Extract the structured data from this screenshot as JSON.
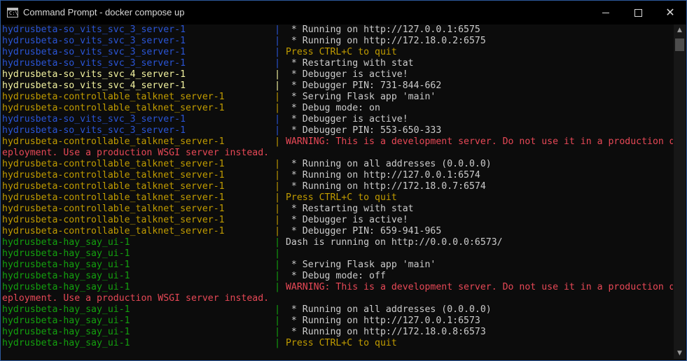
{
  "window": {
    "title": "Command Prompt - docker  compose up",
    "icon_text": "C:\\",
    "icon_name": "cmd-icon",
    "controls": {
      "minimize": "minimize-icon",
      "maximize": "maximize-icon",
      "close": "close-icon"
    }
  },
  "colors": {
    "svc3_blue": "#2a55d6",
    "svc4_yellow": "#f2f2a0",
    "talknet_gold": "#c19c00",
    "hay_say_green": "#13a10e",
    "warning_red": "#e74856",
    "output_white": "#cccccc",
    "frame_border": "#2d5a9e"
  },
  "console": {
    "lines": [
      {
        "prefix": "hydrusbeta-so_vits_svc_3_server-1",
        "pc": "blue",
        "sep": "|",
        "text": " * Running on http://127.0.0.1:6575",
        "tc": "white"
      },
      {
        "prefix": "hydrusbeta-so_vits_svc_3_server-1",
        "pc": "blue",
        "sep": "|",
        "text": " * Running on http://172.18.0.2:6575",
        "tc": "white"
      },
      {
        "prefix": "hydrusbeta-so_vits_svc_3_server-1",
        "pc": "blue",
        "sep": "|",
        "text": "Press CTRL+C to quit",
        "tc": "gold"
      },
      {
        "prefix": "hydrusbeta-so_vits_svc_3_server-1",
        "pc": "blue",
        "sep": "|",
        "text": " * Restarting with stat",
        "tc": "white"
      },
      {
        "prefix": "hydrusbeta-so_vits_svc_4_server-1",
        "pc": "yellow",
        "sep": "|",
        "text": " * Debugger is active!",
        "tc": "white"
      },
      {
        "prefix": "hydrusbeta-so_vits_svc_4_server-1",
        "pc": "yellow",
        "sep": "|",
        "text": " * Debugger PIN: 731-844-662",
        "tc": "white"
      },
      {
        "prefix": "hydrusbeta-controllable_talknet_server-1",
        "pc": "gold",
        "sep": "|",
        "text": " * Serving Flask app 'main'",
        "tc": "white"
      },
      {
        "prefix": "hydrusbeta-controllable_talknet_server-1",
        "pc": "gold",
        "sep": "|",
        "text": " * Debug mode: on",
        "tc": "white"
      },
      {
        "prefix": "hydrusbeta-so_vits_svc_3_server-1",
        "pc": "blue",
        "sep": "|",
        "text": " * Debugger is active!",
        "tc": "white"
      },
      {
        "prefix": "hydrusbeta-so_vits_svc_3_server-1",
        "pc": "blue",
        "sep": "|",
        "text": " * Debugger PIN: 553-650-333",
        "tc": "white"
      },
      {
        "prefix": "hydrusbeta-controllable_talknet_server-1",
        "pc": "gold",
        "sep": "|",
        "text": "WARNING: This is a development server. Do not use it in a production d",
        "tc": "red"
      },
      {
        "prefix": "",
        "pc": "red",
        "sep": "",
        "text": "eployment. Use a production WSGI server instead.",
        "tc": "red"
      },
      {
        "prefix": "hydrusbeta-controllable_talknet_server-1",
        "pc": "gold",
        "sep": "|",
        "text": " * Running on all addresses (0.0.0.0)",
        "tc": "white"
      },
      {
        "prefix": "hydrusbeta-controllable_talknet_server-1",
        "pc": "gold",
        "sep": "|",
        "text": " * Running on http://127.0.0.1:6574",
        "tc": "white"
      },
      {
        "prefix": "hydrusbeta-controllable_talknet_server-1",
        "pc": "gold",
        "sep": "|",
        "text": " * Running on http://172.18.0.7:6574",
        "tc": "white"
      },
      {
        "prefix": "hydrusbeta-controllable_talknet_server-1",
        "pc": "gold",
        "sep": "|",
        "text": "Press CTRL+C to quit",
        "tc": "gold"
      },
      {
        "prefix": "hydrusbeta-controllable_talknet_server-1",
        "pc": "gold",
        "sep": "|",
        "text": " * Restarting with stat",
        "tc": "white"
      },
      {
        "prefix": "hydrusbeta-controllable_talknet_server-1",
        "pc": "gold",
        "sep": "|",
        "text": " * Debugger is active!",
        "tc": "white"
      },
      {
        "prefix": "hydrusbeta-controllable_talknet_server-1",
        "pc": "gold",
        "sep": "|",
        "text": " * Debugger PIN: 659-941-965",
        "tc": "white"
      },
      {
        "prefix": "hydrusbeta-hay_say_ui-1",
        "pc": "green",
        "sep": "|",
        "text": "Dash is running on http://0.0.0.0:6573/",
        "tc": "white"
      },
      {
        "prefix": "hydrusbeta-hay_say_ui-1",
        "pc": "green",
        "sep": "|",
        "text": "",
        "tc": "white"
      },
      {
        "prefix": "hydrusbeta-hay_say_ui-1",
        "pc": "green",
        "sep": "|",
        "text": " * Serving Flask app 'main'",
        "tc": "white"
      },
      {
        "prefix": "hydrusbeta-hay_say_ui-1",
        "pc": "green",
        "sep": "|",
        "text": " * Debug mode: off",
        "tc": "white"
      },
      {
        "prefix": "hydrusbeta-hay_say_ui-1",
        "pc": "green",
        "sep": "|",
        "text": "WARNING: This is a development server. Do not use it in a production d",
        "tc": "red"
      },
      {
        "prefix": "",
        "pc": "red",
        "sep": "",
        "text": "eployment. Use a production WSGI server instead.",
        "tc": "red"
      },
      {
        "prefix": "hydrusbeta-hay_say_ui-1",
        "pc": "green",
        "sep": "|",
        "text": " * Running on all addresses (0.0.0.0)",
        "tc": "white"
      },
      {
        "prefix": "hydrusbeta-hay_say_ui-1",
        "pc": "green",
        "sep": "|",
        "text": " * Running on http://127.0.0.1:6573",
        "tc": "white"
      },
      {
        "prefix": "hydrusbeta-hay_say_ui-1",
        "pc": "green",
        "sep": "|",
        "text": " * Running on http://172.18.0.8:6573",
        "tc": "white"
      },
      {
        "prefix": "hydrusbeta-hay_say_ui-1",
        "pc": "green",
        "sep": "|",
        "text": "Press CTRL+C to quit",
        "tc": "gold"
      }
    ]
  },
  "scrollbar": {
    "up_icon": "scroll-up-icon",
    "down_icon": "scroll-down-icon"
  }
}
